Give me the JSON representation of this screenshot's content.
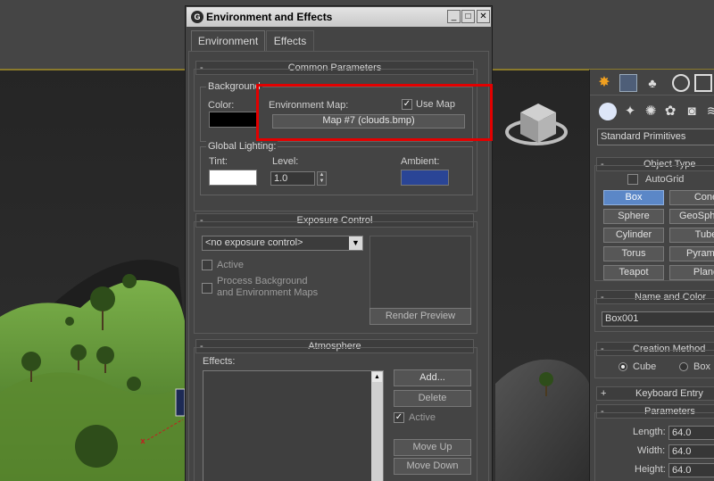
{
  "dialog": {
    "title": "Environment and Effects",
    "tabs": [
      "Environment",
      "Effects"
    ],
    "common_parameters": {
      "header": "Common Parameters",
      "background_group": "Background",
      "color_label": "Color:",
      "color_value": "#000000",
      "environment_map_label": "Environment Map:",
      "use_map_label": "Use Map",
      "use_map_checked": true,
      "map_button": "Map #7 (clouds.bmp)",
      "global_lighting_group": "Global Lighting:",
      "tint_label": "Tint:",
      "tint_value": "#ffffff",
      "level_label": "Level:",
      "level_value": "1.0",
      "ambient_label": "Ambient:",
      "ambient_value": "#2a4596"
    },
    "exposure_control": {
      "header": "Exposure Control",
      "dropdown_value": "<no exposure control>",
      "active_label": "Active",
      "process_label_line1": "Process Background",
      "process_label_line2": "and Environment Maps",
      "render_preview": "Render Preview"
    },
    "atmosphere": {
      "header": "Atmosphere",
      "effects_label": "Effects:",
      "add": "Add...",
      "delete": "Delete",
      "active_label": "Active",
      "active_checked": true,
      "move_up": "Move Up",
      "move_down": "Move Down"
    }
  },
  "command_panel": {
    "dropdown": "Standard Primitives",
    "object_type": {
      "header": "Object Type",
      "autogrid": "AutoGrid",
      "buttons": [
        "Box",
        "Cone",
        "Sphere",
        "GeoSphere",
        "Cylinder",
        "Tube",
        "Torus",
        "Pyramid",
        "Teapot",
        "Plane"
      ],
      "selected": "Box"
    },
    "name_and_color": {
      "header": "Name and Color",
      "name": "Box001"
    },
    "creation_method": {
      "header": "Creation Method",
      "option_cube": "Cube",
      "option_box": "Box",
      "selected": "Cube"
    },
    "keyboard_entry": {
      "header": "Keyboard Entry"
    },
    "parameters": {
      "header": "Parameters",
      "length_label": "Length:",
      "length_value": "64.0",
      "width_label": "Width:",
      "width_value": "64.0",
      "height_label": "Height:",
      "height_value": "64.0"
    }
  },
  "colors": {
    "selected_button": "#5b87c7",
    "highlight_border": "#e30000",
    "terrain": "#5f9030"
  }
}
